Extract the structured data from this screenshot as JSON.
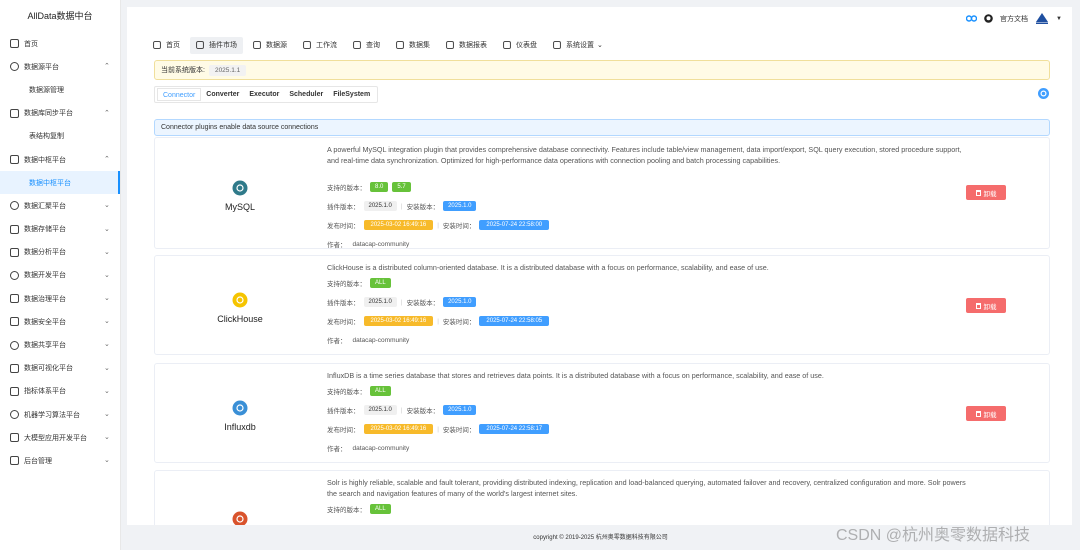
{
  "app": {
    "title": "AllData数据中台"
  },
  "sidebar": {
    "items": [
      {
        "label": "首页",
        "icon": "home-icon",
        "expanded": null
      },
      {
        "label": "数据源平台",
        "icon": "database-icon",
        "expanded": true,
        "children": [
          "数据源管理"
        ]
      },
      {
        "label": "数据库同步平台",
        "icon": "sync-icon",
        "expanded": true,
        "children": [
          "表结构复制"
        ]
      },
      {
        "label": "数据中枢平台",
        "icon": "hub-icon",
        "expanded": true,
        "children": [
          "数据中枢平台"
        ]
      },
      {
        "label": "数据汇聚平台",
        "icon": "collect-icon",
        "expanded": false
      },
      {
        "label": "数据存储平台",
        "icon": "storage-icon",
        "expanded": false
      },
      {
        "label": "数据分析平台",
        "icon": "analysis-icon",
        "expanded": false
      },
      {
        "label": "数据开发平台",
        "icon": "develop-icon",
        "expanded": false
      },
      {
        "label": "数据治理平台",
        "icon": "governance-icon",
        "expanded": false
      },
      {
        "label": "数据安全平台",
        "icon": "security-icon",
        "expanded": false
      },
      {
        "label": "数据共享平台",
        "icon": "share-icon",
        "expanded": false
      },
      {
        "label": "数据可视化平台",
        "icon": "visual-icon",
        "expanded": false
      },
      {
        "label": "指标体系平台",
        "icon": "metric-icon",
        "expanded": false
      },
      {
        "label": "机器学习算法平台",
        "icon": "ml-icon",
        "expanded": false
      },
      {
        "label": "大模型应用开发平台",
        "icon": "llm-icon",
        "expanded": false
      },
      {
        "label": "后台管理",
        "icon": "admin-icon",
        "expanded": false
      }
    ]
  },
  "topbar": {
    "docs_label": "官方文档"
  },
  "nav": {
    "items": [
      {
        "label": "首页",
        "icon": "home-icon",
        "active": false
      },
      {
        "label": "插件市场",
        "icon": "store-icon",
        "active": true
      },
      {
        "label": "数据源",
        "icon": "list-icon",
        "active": false
      },
      {
        "label": "工作流",
        "icon": "workflow-icon",
        "active": false
      },
      {
        "label": "查询",
        "icon": "terminal-icon",
        "active": false
      },
      {
        "label": "数据集",
        "icon": "dataset-icon",
        "active": false
      },
      {
        "label": "数据报表",
        "icon": "report-icon",
        "active": false
      },
      {
        "label": "仪表盘",
        "icon": "dashboard-icon",
        "active": false
      },
      {
        "label": "系统设置",
        "icon": "settings-icon",
        "active": false,
        "dropdown": true
      }
    ]
  },
  "version": {
    "label": "当前系统版本:",
    "value": "2025.1.1"
  },
  "tabs": [
    "Connector",
    "Converter",
    "Executor",
    "Scheduler",
    "FileSystem"
  ],
  "active_tab": 0,
  "info": "Connector plugins enable data source connections",
  "labels": {
    "supported_versions": "支持的版本：",
    "plugin_version": "插件版本：",
    "installed_version": "安装版本：",
    "publish_time": "发布时间：",
    "install_time": "安装时间：",
    "author": "作者：",
    "uninstall": "卸载"
  },
  "plugins": [
    {
      "name": "MySQL",
      "logo_color": "#2f7a8a",
      "description": "A powerful MySQL integration plugin that provides comprehensive database connectivity. Features include table/view management, data import/export, SQL query execution, stored procedure support, and real-time data synchronization. Optimized for high-performance data operations with connection pooling and batch processing capabilities.",
      "supported": [
        "8.0",
        "5.7"
      ],
      "plugin_version": "2025.1.0",
      "installed_version": "2025.1.0",
      "publish_time": "2025-03-02 16:49:16",
      "install_time": "2025-07-24 22:58:00",
      "author": "datacap-community"
    },
    {
      "name": "ClickHouse",
      "logo_color": "#f5c400",
      "description": "ClickHouse is a distributed column-oriented database. It is a distributed database with a focus on performance, scalability, and ease of use.",
      "supported": [
        "ALL"
      ],
      "plugin_version": "2025.1.0",
      "installed_version": "2025.1.0",
      "publish_time": "2025-03-02 16:49:16",
      "install_time": "2025-07-24 22:58:05",
      "author": "datacap-community"
    },
    {
      "name": "Influxdb",
      "logo_color": "#3a8fd6",
      "description": "InfluxDB is a time series database that stores and retrieves data points. It is a distributed database with a focus on performance, scalability, and ease of use.",
      "supported": [
        "ALL"
      ],
      "plugin_version": "2025.1.0",
      "installed_version": "2025.1.0",
      "publish_time": "2025-03-02 16:49:16",
      "install_time": "2025-07-24 22:58:17",
      "author": "datacap-community"
    },
    {
      "name": "",
      "logo_color": "#d9532c",
      "description": "Solr is highly reliable, scalable and fault tolerant, providing distributed indexing, replication and load-balanced querying, automated failover and recovery, centralized configuration and more. Solr powers the search and navigation features of many of the world's largest internet sites.",
      "supported": [
        "ALL"
      ]
    }
  ],
  "footer": "copyright © 2019-2025 杭州奥零数据科技有限公司",
  "watermark": "CSDN @杭州奥零数据科技"
}
